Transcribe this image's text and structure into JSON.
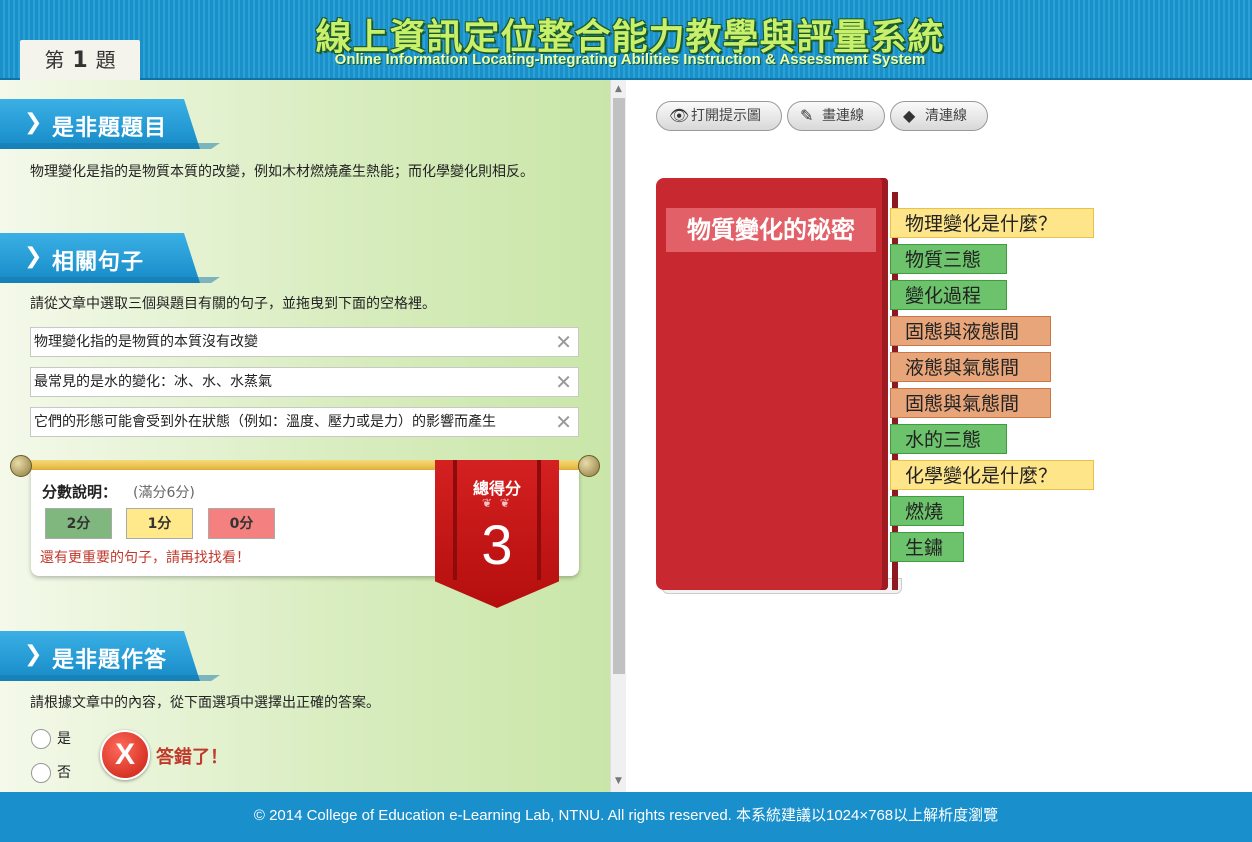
{
  "header": {
    "title_zh": "線上資訊定位整合能力教學與評量系統",
    "title_en": "Online Information Locating-Integrating Abilities Instruction & Assessment System",
    "question_tab": {
      "prefix": "第",
      "number": "1",
      "suffix": "題"
    }
  },
  "sections": {
    "question": {
      "heading": "是非題題目",
      "text": "物理變化是指的是物質本質的改變，例如木材燃燒產生熱能；而化學變化則相反。"
    },
    "sentences": {
      "heading": "相關句子",
      "instruction": "請從文章中選取三個與題目有關的句子，並拖曳到下面的空格裡。",
      "items": [
        "物理變化指的是物質的本質沒有改變",
        "最常見的是水的變化：冰、水、水蒸氣",
        "它們的形態可能會受到外在狀態（例如：溫度、壓力或是力）的影響而產生"
      ],
      "clear_icon": "close-icon"
    },
    "score": {
      "title": "分數說明：",
      "full_mark": "(滿分6分)",
      "levels": [
        {
          "label": "2分",
          "color": "#7fb77f"
        },
        {
          "label": "1分",
          "color": "#ffe98a"
        },
        {
          "label": "0分",
          "color": "#f48080"
        }
      ],
      "message": "還有更重要的句子，請再找找看！",
      "total_label": "總得分",
      "total_value": "3"
    },
    "answer": {
      "heading": "是非題作答",
      "instruction": "請根據文章中的內容，從下面選項中選擇出正確的答案。",
      "options": [
        "是",
        "否"
      ],
      "result_text": "答錯了！",
      "result_icon": "wrong-icon"
    }
  },
  "toolbar": {
    "show_hint": "打開提示圖",
    "draw_line": "畫連線",
    "clear_line": "清連線"
  },
  "book": {
    "title": "物質變化的秘密",
    "tabs": [
      {
        "label": "物理變化是什麼？",
        "color": "yellow"
      },
      {
        "label": "物質三態",
        "color": "green"
      },
      {
        "label": "變化過程",
        "color": "green"
      },
      {
        "label": "固態與液態間",
        "color": "orange"
      },
      {
        "label": "液態與氣態間",
        "color": "orange"
      },
      {
        "label": "固態與氣態間",
        "color": "orange"
      },
      {
        "label": "水的三態",
        "color": "green"
      },
      {
        "label": "化學變化是什麼？",
        "color": "yellow"
      },
      {
        "label": "燃燒",
        "color": "green"
      },
      {
        "label": "生鏽",
        "color": "green"
      }
    ]
  },
  "footer": {
    "text": "© 2014 College of Education e-Learning Lab, NTNU. All rights reserved. 本系統建議以1024×768以上解析度瀏覽"
  }
}
